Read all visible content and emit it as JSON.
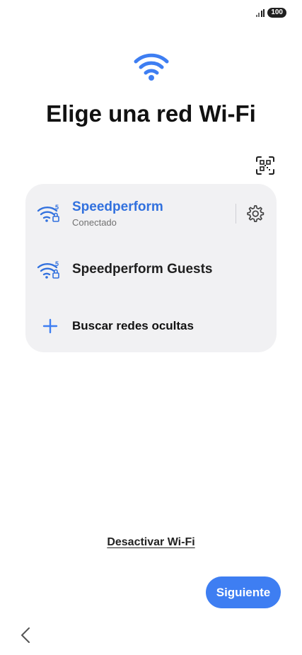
{
  "status_bar": {
    "battery": "100",
    "signal_icon": "signal-icon"
  },
  "header": {
    "title": "Elige una red Wi-Fi",
    "icon": "wifi-icon"
  },
  "qr_button": {
    "icon": "qr-scan-icon"
  },
  "networks": [
    {
      "name": "Speedperform",
      "status": "Conectado",
      "band": "5",
      "secured": true,
      "connected": true,
      "settings_icon": "gear-icon"
    },
    {
      "name": "Speedperform Guests",
      "band": "5",
      "secured": true,
      "connected": false
    }
  ],
  "hidden_networks": {
    "label": "Buscar redes ocultas",
    "icon": "plus-icon"
  },
  "footer": {
    "deactivate_label": "Desactivar Wi-Fi",
    "next_label": "Siguiente",
    "back_icon": "chevron-left-icon"
  },
  "colors": {
    "accent": "#3e7ef2",
    "connected_text": "#3271de",
    "card_background": "#f1f1f3"
  }
}
